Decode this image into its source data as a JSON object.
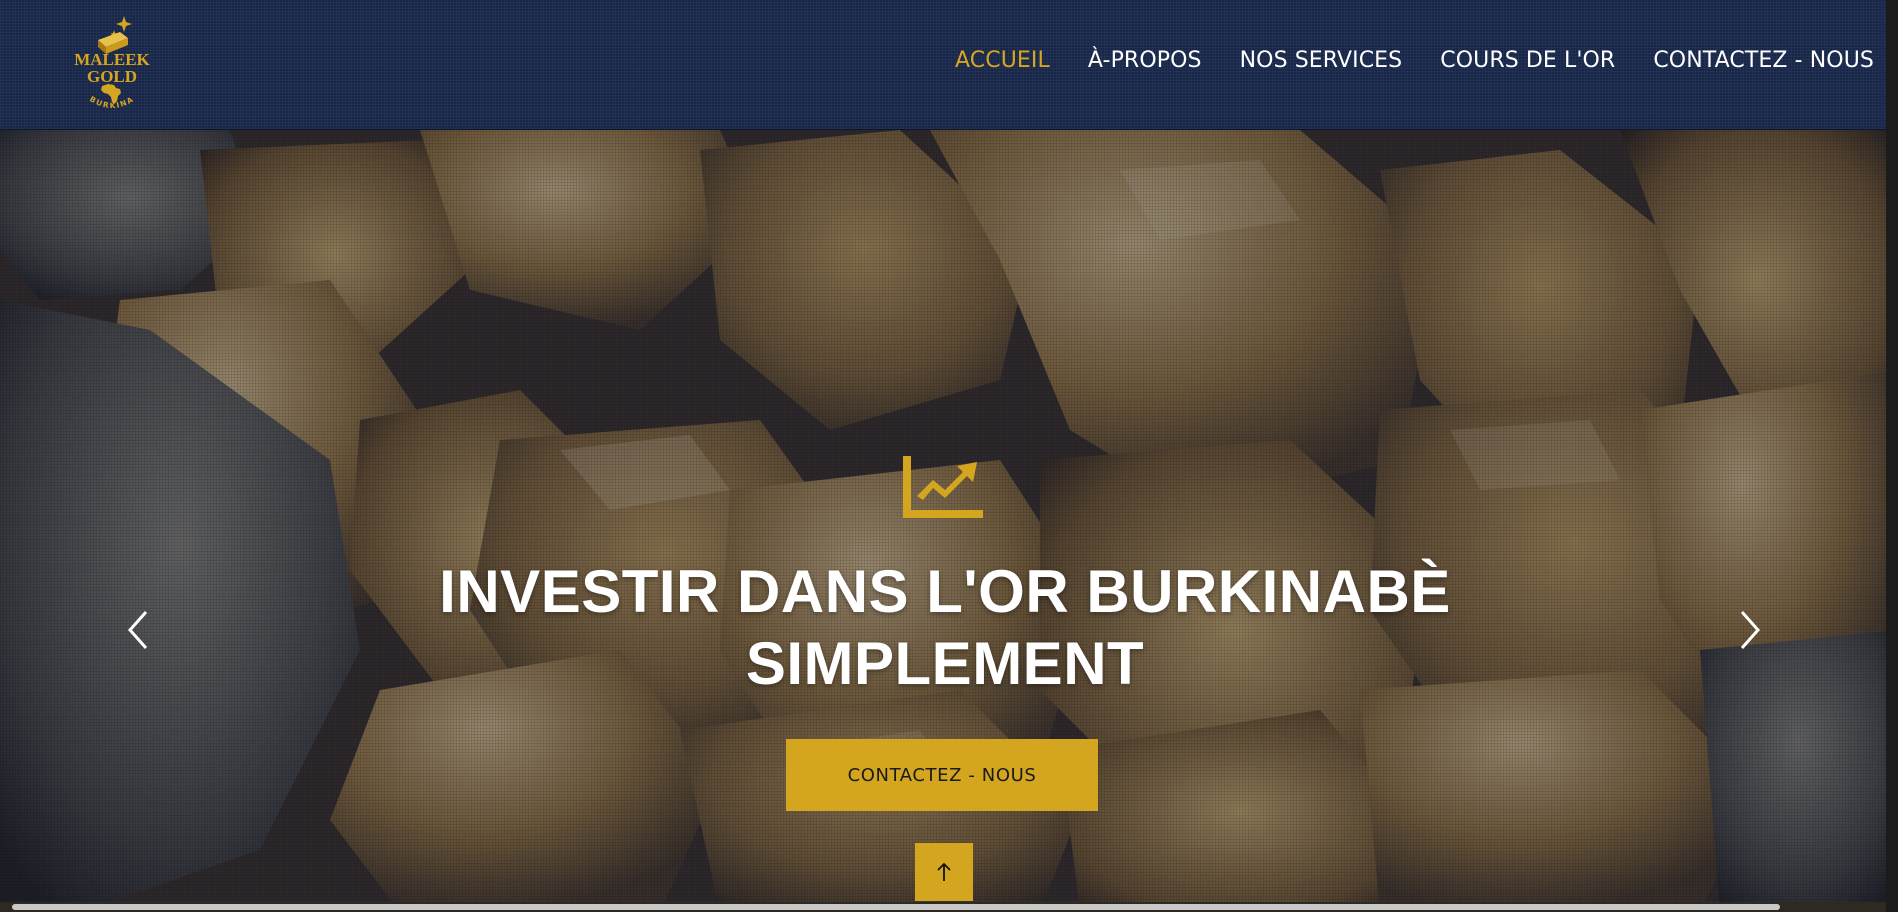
{
  "header": {
    "logo": {
      "line1": "MALEEK",
      "line2": "GOLD",
      "line3": "BURKINA",
      "icon": "gold-bar-africa-logo"
    },
    "nav": [
      {
        "label": "ACCUEIL",
        "active": true
      },
      {
        "label": "À-PROPOS",
        "active": false
      },
      {
        "label": "NOS SERVICES",
        "active": false
      },
      {
        "label": "COURS DE L'OR",
        "active": false
      },
      {
        "label": "CONTACTEZ - NOUS",
        "active": false
      }
    ]
  },
  "hero": {
    "icon": "chart-line-up-icon",
    "title_line1": "INVESTIR DANS L'OR BURKINABÈ",
    "title_line2": "SIMPLEMENT",
    "cta_label": "CONTACTEZ - NOUS",
    "prev_icon": "chevron-left-icon",
    "next_icon": "chevron-right-icon",
    "scroll_top_icon": "arrow-up-icon"
  },
  "colors": {
    "brand_gold": "#d4a61f",
    "header_navy": "#18264a",
    "nav_active": "#d4a621",
    "text_white": "#ffffff"
  }
}
